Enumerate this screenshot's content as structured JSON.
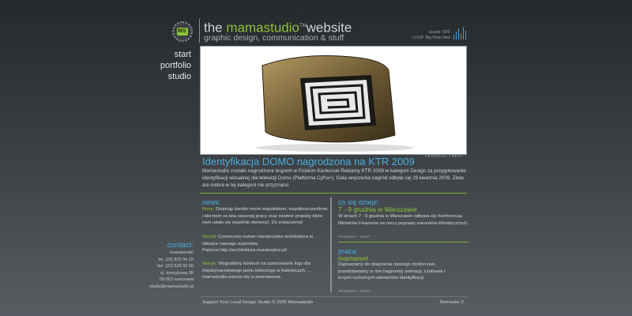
{
  "header": {
    "title_prefix": "the ",
    "brand": "mamastudio",
    "brand_tm": "TM",
    "title_suffix": "website",
    "tagline": "graphic design, communication & stuff",
    "logo_text": "MS",
    "sound_label": "Sound: OFF",
    "loop_label": "LOOP: Big Plum Idea"
  },
  "nav": {
    "items": [
      "start",
      "portfolio",
      "studio"
    ]
  },
  "feature": {
    "image_caption": "PRZODUJĄ • NEXT",
    "title": "Identyfikacja DOMO nagrodzona na KTR 2009",
    "body": "Mamastudio zostało nagrodzone brązem w Polskim Konkursie Reklamy KTR 2009 w kategorii Design za przygotowanie identyfikacji wizualnej dla telewizji Domo (Platforma Cyfra+). Gala wręczenia nagród odbyła się 29 kwietnia 2009. Złota ani srebra w tej kategorii nie przyznano."
  },
  "news": {
    "title": "news:",
    "items": [
      {
        "who": "Rene:",
        "text": "Dziękuję bardzo moim współnikom, współpracownikom i klientom za lata owocnej pracy oraz świetne projekty które nam udało się wspólnie stworzyć. Do zobaczenia!"
      },
      {
        "who": "Michał:",
        "text": "Czerwcowy numer miesięcznika architektura w okładce naszego autorstwa.",
        "link": "Patrzcie:http://architektura.muratorplus.pl/"
      },
      {
        "who": "Marcin:",
        "text": "Wygraliśmy konkurs na opracowanie logo dla międzynarodowego portu lotniczego w Katowicach. ... mamastudio wznosi się w przestworza."
      }
    ]
  },
  "events": {
    "title": "co się dzieje:",
    "subtitle": "7 - 9 grudnia w Warszawie",
    "body": "W dniach 7 - 9 grudnia w Warszawie odbywa się Konferencja Ministrów Finansów na rzecz poprawy warunków klimatycznych.",
    "nav": "PRZEDNI • NEXT"
  },
  "jobs": {
    "title": "praca:",
    "subtitle": "mamareel",
    "body": "Zapraszamy do obejrzenia naszego motion-reel, przedstawiamy w nim fragmenty animacji, czołówek i innych ruchomych elementów identyfikacji.",
    "nav": "PRZEDNI • NEXT"
  },
  "contact": {
    "title": "contact:",
    "lines": [
      "mamastudio",
      "tel. (22) 825 94 15",
      "fax. (22) 626 92 90",
      "ul. koszykowa 35",
      "00-553 warszawa",
      "studio@mamastudio.pl"
    ]
  },
  "footer": {
    "left": "Support Your Local Design Studio © 2005 Mamastudio",
    "right": "Remaster 2"
  },
  "colors": {
    "accent_blue": "#49aee0",
    "accent_green": "#8fc23a"
  }
}
